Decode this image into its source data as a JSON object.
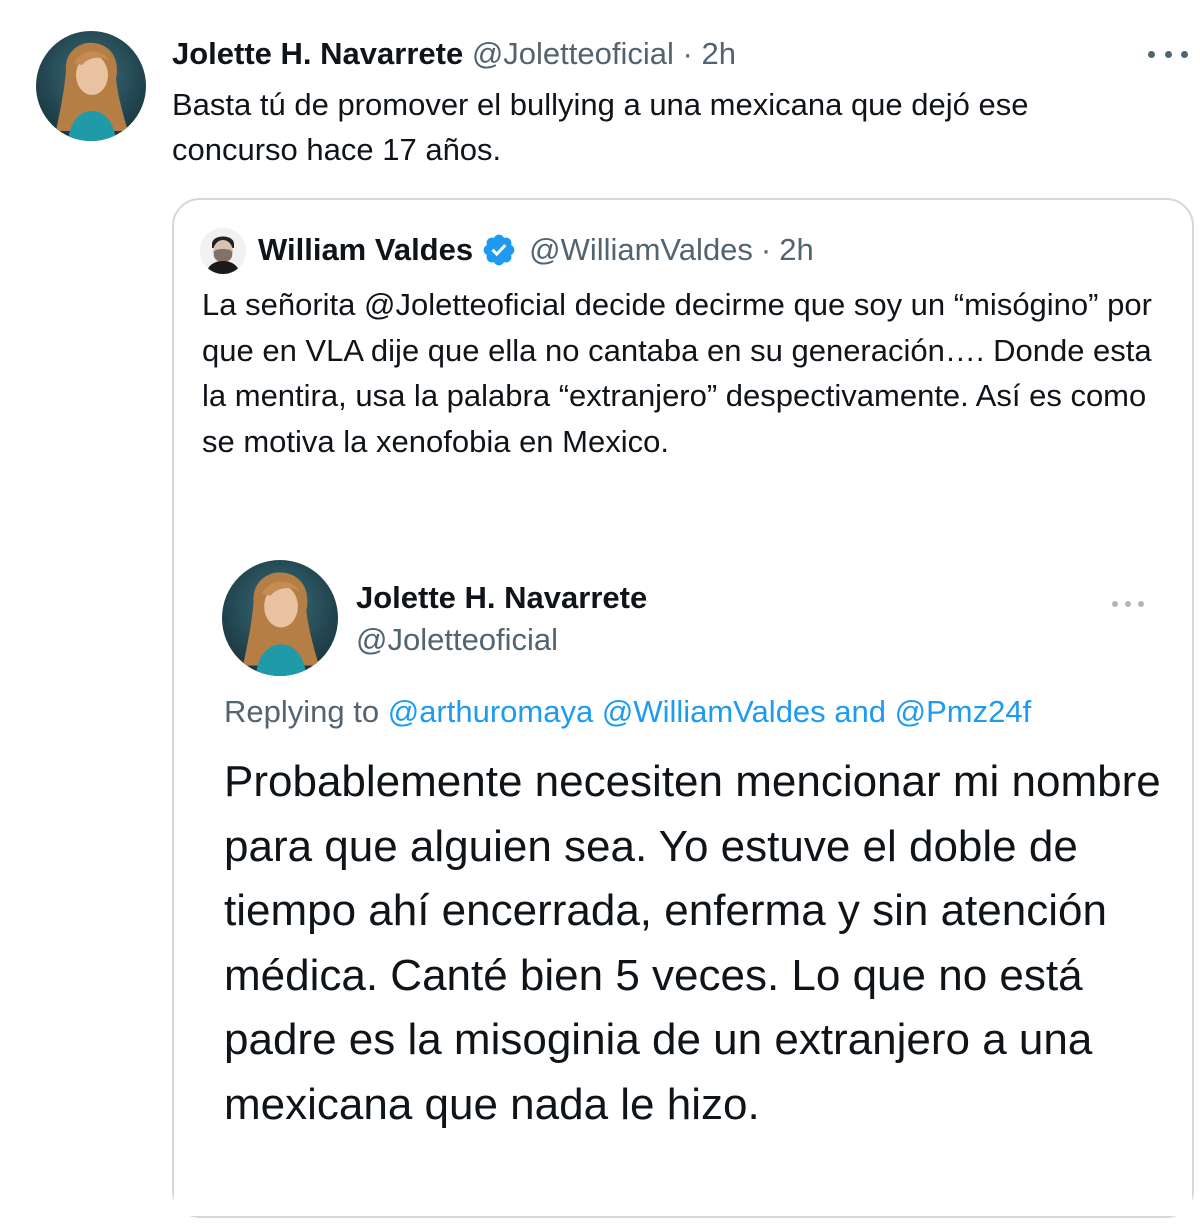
{
  "tweet": {
    "author_name": "Jolette H. Navarrete",
    "author_handle": "@Joletteoficial",
    "separator": "·",
    "time": "2h",
    "text": "Basta tú de promover el bullying a una mexicana que dejó ese concurso hace 17 años."
  },
  "quoted": {
    "author_name": "William Valdes",
    "author_handle": "@WilliamValdes",
    "separator": "·",
    "time": "2h",
    "text": "La señorita @Joletteoficial decide decirme que soy un “misógino” por que en VLA dije que ella no cantaba en su generación…. Donde esta la mentira, usa la palabra “extranjero” despectivamente. Así es como se motiva la xenofobia en Mexico.",
    "verified_color": "#1d9bf0"
  },
  "embedded": {
    "author_name": "Jolette H. Navarrete",
    "author_handle": "@Joletteoficial",
    "replying_prefix": "Replying to",
    "mention1": "@arthuromaya",
    "mention2": "@WilliamValdes",
    "and_word": "and",
    "mention3": "@Pmz24f",
    "text": "Probablemente necesiten mencionar mi nombre para que alguien sea. Yo estuve el doble de tiempo ahí encerrada, enferma y sin atención médica. Canté bien 5 veces. Lo que no está padre es la misoginia de un extranjero a una mexicana que nada le hizo."
  },
  "icons": {
    "more": "more-horizontal-icon",
    "verified": "verified-badge-icon"
  },
  "colors": {
    "text_primary": "#0f1419",
    "text_secondary": "#536471",
    "link": "#1d9bf0",
    "border": "#cfd9de"
  }
}
